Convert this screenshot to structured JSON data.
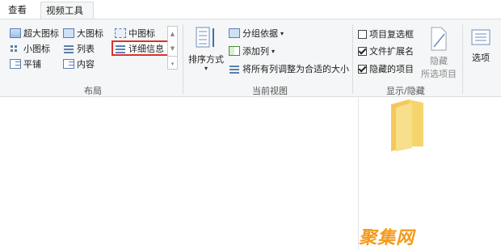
{
  "tabs": {
    "view": "查看",
    "video_tools": "视频工具"
  },
  "layout_group": {
    "label": "布局",
    "items": {
      "extra_large": "超大图标",
      "large": "大图标",
      "medium": "中图标",
      "small": "小图标",
      "list": "列表",
      "details": "详细信息",
      "tiles": "平铺",
      "content": "内容"
    },
    "selected": "详细信息"
  },
  "current_view_group": {
    "label": "当前视图",
    "sort_by": "排序方式",
    "group_by": "分组依据",
    "add_columns": "添加列",
    "size_all_columns": "将所有列调整为合适的大小"
  },
  "show_hide_group": {
    "label": "显示/隐藏",
    "item_checkboxes": {
      "label": "项目复选框",
      "checked": false
    },
    "file_extensions": {
      "label": "文件扩展名",
      "checked": true
    },
    "hidden_items": {
      "label": "隐藏的项目",
      "checked": true
    },
    "hide_selected_line1": "隐藏",
    "hide_selected_line2": "所选项目"
  },
  "options": {
    "label": "选项"
  },
  "watermark": "聚集网",
  "colors": {
    "highlight_border": "#e0302b",
    "ribbon_bg": "#f5f6f7",
    "folder": "#f6d56e",
    "watermark": "#f39a1e"
  }
}
